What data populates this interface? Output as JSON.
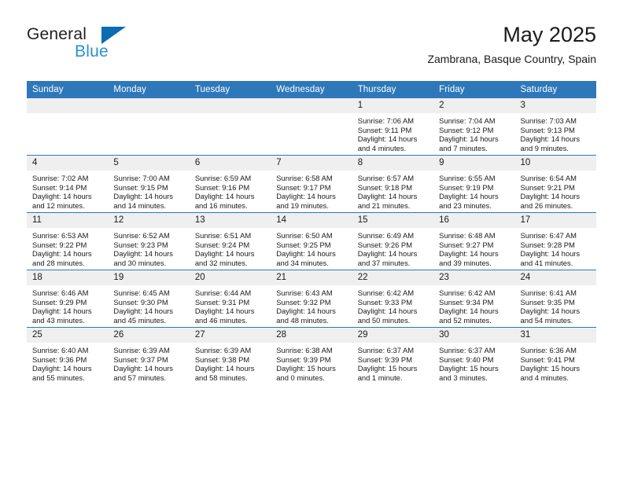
{
  "logo": {
    "word1": "General",
    "word2": "Blue",
    "triangle_color": "#0A6CB4",
    "word2_color": "#2A8FD4"
  },
  "header": {
    "title": "May 2025",
    "subtitle": "Zambrana, Basque Country, Spain"
  },
  "theme": {
    "header_bg": "#2E78BA",
    "header_text": "#FFFFFF",
    "daynum_bg": "#EFEFEF",
    "row_divider": "#2E78BA",
    "body_text": "#1A1A1A"
  },
  "labels": {
    "sunrise_prefix": "Sunrise:",
    "sunset_prefix": "Sunset:",
    "daylight_prefix": "Daylight:"
  },
  "weekday_headers": [
    "Sunday",
    "Monday",
    "Tuesday",
    "Wednesday",
    "Thursday",
    "Friday",
    "Saturday"
  ],
  "weeks": [
    [
      {
        "day": "",
        "blank": true,
        "sunrise": "",
        "sunset": "",
        "daylight_l1": "",
        "daylight_l2": ""
      },
      {
        "day": "",
        "blank": true,
        "sunrise": "",
        "sunset": "",
        "daylight_l1": "",
        "daylight_l2": ""
      },
      {
        "day": "",
        "blank": true,
        "sunrise": "",
        "sunset": "",
        "daylight_l1": "",
        "daylight_l2": ""
      },
      {
        "day": "",
        "blank": true,
        "sunrise": "",
        "sunset": "",
        "daylight_l1": "",
        "daylight_l2": ""
      },
      {
        "day": "1",
        "blank": false,
        "sunrise": "Sunrise: 7:06 AM",
        "sunset": "Sunset: 9:11 PM",
        "daylight_l1": "Daylight: 14 hours",
        "daylight_l2": "and 4 minutes."
      },
      {
        "day": "2",
        "blank": false,
        "sunrise": "Sunrise: 7:04 AM",
        "sunset": "Sunset: 9:12 PM",
        "daylight_l1": "Daylight: 14 hours",
        "daylight_l2": "and 7 minutes."
      },
      {
        "day": "3",
        "blank": false,
        "sunrise": "Sunrise: 7:03 AM",
        "sunset": "Sunset: 9:13 PM",
        "daylight_l1": "Daylight: 14 hours",
        "daylight_l2": "and 9 minutes."
      }
    ],
    [
      {
        "day": "4",
        "blank": false,
        "sunrise": "Sunrise: 7:02 AM",
        "sunset": "Sunset: 9:14 PM",
        "daylight_l1": "Daylight: 14 hours",
        "daylight_l2": "and 12 minutes."
      },
      {
        "day": "5",
        "blank": false,
        "sunrise": "Sunrise: 7:00 AM",
        "sunset": "Sunset: 9:15 PM",
        "daylight_l1": "Daylight: 14 hours",
        "daylight_l2": "and 14 minutes."
      },
      {
        "day": "6",
        "blank": false,
        "sunrise": "Sunrise: 6:59 AM",
        "sunset": "Sunset: 9:16 PM",
        "daylight_l1": "Daylight: 14 hours",
        "daylight_l2": "and 16 minutes."
      },
      {
        "day": "7",
        "blank": false,
        "sunrise": "Sunrise: 6:58 AM",
        "sunset": "Sunset: 9:17 PM",
        "daylight_l1": "Daylight: 14 hours",
        "daylight_l2": "and 19 minutes."
      },
      {
        "day": "8",
        "blank": false,
        "sunrise": "Sunrise: 6:57 AM",
        "sunset": "Sunset: 9:18 PM",
        "daylight_l1": "Daylight: 14 hours",
        "daylight_l2": "and 21 minutes."
      },
      {
        "day": "9",
        "blank": false,
        "sunrise": "Sunrise: 6:55 AM",
        "sunset": "Sunset: 9:19 PM",
        "daylight_l1": "Daylight: 14 hours",
        "daylight_l2": "and 23 minutes."
      },
      {
        "day": "10",
        "blank": false,
        "sunrise": "Sunrise: 6:54 AM",
        "sunset": "Sunset: 9:21 PM",
        "daylight_l1": "Daylight: 14 hours",
        "daylight_l2": "and 26 minutes."
      }
    ],
    [
      {
        "day": "11",
        "blank": false,
        "sunrise": "Sunrise: 6:53 AM",
        "sunset": "Sunset: 9:22 PM",
        "daylight_l1": "Daylight: 14 hours",
        "daylight_l2": "and 28 minutes."
      },
      {
        "day": "12",
        "blank": false,
        "sunrise": "Sunrise: 6:52 AM",
        "sunset": "Sunset: 9:23 PM",
        "daylight_l1": "Daylight: 14 hours",
        "daylight_l2": "and 30 minutes."
      },
      {
        "day": "13",
        "blank": false,
        "sunrise": "Sunrise: 6:51 AM",
        "sunset": "Sunset: 9:24 PM",
        "daylight_l1": "Daylight: 14 hours",
        "daylight_l2": "and 32 minutes."
      },
      {
        "day": "14",
        "blank": false,
        "sunrise": "Sunrise: 6:50 AM",
        "sunset": "Sunset: 9:25 PM",
        "daylight_l1": "Daylight: 14 hours",
        "daylight_l2": "and 34 minutes."
      },
      {
        "day": "15",
        "blank": false,
        "sunrise": "Sunrise: 6:49 AM",
        "sunset": "Sunset: 9:26 PM",
        "daylight_l1": "Daylight: 14 hours",
        "daylight_l2": "and 37 minutes."
      },
      {
        "day": "16",
        "blank": false,
        "sunrise": "Sunrise: 6:48 AM",
        "sunset": "Sunset: 9:27 PM",
        "daylight_l1": "Daylight: 14 hours",
        "daylight_l2": "and 39 minutes."
      },
      {
        "day": "17",
        "blank": false,
        "sunrise": "Sunrise: 6:47 AM",
        "sunset": "Sunset: 9:28 PM",
        "daylight_l1": "Daylight: 14 hours",
        "daylight_l2": "and 41 minutes."
      }
    ],
    [
      {
        "day": "18",
        "blank": false,
        "sunrise": "Sunrise: 6:46 AM",
        "sunset": "Sunset: 9:29 PM",
        "daylight_l1": "Daylight: 14 hours",
        "daylight_l2": "and 43 minutes."
      },
      {
        "day": "19",
        "blank": false,
        "sunrise": "Sunrise: 6:45 AM",
        "sunset": "Sunset: 9:30 PM",
        "daylight_l1": "Daylight: 14 hours",
        "daylight_l2": "and 45 minutes."
      },
      {
        "day": "20",
        "blank": false,
        "sunrise": "Sunrise: 6:44 AM",
        "sunset": "Sunset: 9:31 PM",
        "daylight_l1": "Daylight: 14 hours",
        "daylight_l2": "and 46 minutes."
      },
      {
        "day": "21",
        "blank": false,
        "sunrise": "Sunrise: 6:43 AM",
        "sunset": "Sunset: 9:32 PM",
        "daylight_l1": "Daylight: 14 hours",
        "daylight_l2": "and 48 minutes."
      },
      {
        "day": "22",
        "blank": false,
        "sunrise": "Sunrise: 6:42 AM",
        "sunset": "Sunset: 9:33 PM",
        "daylight_l1": "Daylight: 14 hours",
        "daylight_l2": "and 50 minutes."
      },
      {
        "day": "23",
        "blank": false,
        "sunrise": "Sunrise: 6:42 AM",
        "sunset": "Sunset: 9:34 PM",
        "daylight_l1": "Daylight: 14 hours",
        "daylight_l2": "and 52 minutes."
      },
      {
        "day": "24",
        "blank": false,
        "sunrise": "Sunrise: 6:41 AM",
        "sunset": "Sunset: 9:35 PM",
        "daylight_l1": "Daylight: 14 hours",
        "daylight_l2": "and 54 minutes."
      }
    ],
    [
      {
        "day": "25",
        "blank": false,
        "sunrise": "Sunrise: 6:40 AM",
        "sunset": "Sunset: 9:36 PM",
        "daylight_l1": "Daylight: 14 hours",
        "daylight_l2": "and 55 minutes."
      },
      {
        "day": "26",
        "blank": false,
        "sunrise": "Sunrise: 6:39 AM",
        "sunset": "Sunset: 9:37 PM",
        "daylight_l1": "Daylight: 14 hours",
        "daylight_l2": "and 57 minutes."
      },
      {
        "day": "27",
        "blank": false,
        "sunrise": "Sunrise: 6:39 AM",
        "sunset": "Sunset: 9:38 PM",
        "daylight_l1": "Daylight: 14 hours",
        "daylight_l2": "and 58 minutes."
      },
      {
        "day": "28",
        "blank": false,
        "sunrise": "Sunrise: 6:38 AM",
        "sunset": "Sunset: 9:39 PM",
        "daylight_l1": "Daylight: 15 hours",
        "daylight_l2": "and 0 minutes."
      },
      {
        "day": "29",
        "blank": false,
        "sunrise": "Sunrise: 6:37 AM",
        "sunset": "Sunset: 9:39 PM",
        "daylight_l1": "Daylight: 15 hours",
        "daylight_l2": "and 1 minute."
      },
      {
        "day": "30",
        "blank": false,
        "sunrise": "Sunrise: 6:37 AM",
        "sunset": "Sunset: 9:40 PM",
        "daylight_l1": "Daylight: 15 hours",
        "daylight_l2": "and 3 minutes."
      },
      {
        "day": "31",
        "blank": false,
        "sunrise": "Sunrise: 6:36 AM",
        "sunset": "Sunset: 9:41 PM",
        "daylight_l1": "Daylight: 15 hours",
        "daylight_l2": "and 4 minutes."
      }
    ]
  ]
}
